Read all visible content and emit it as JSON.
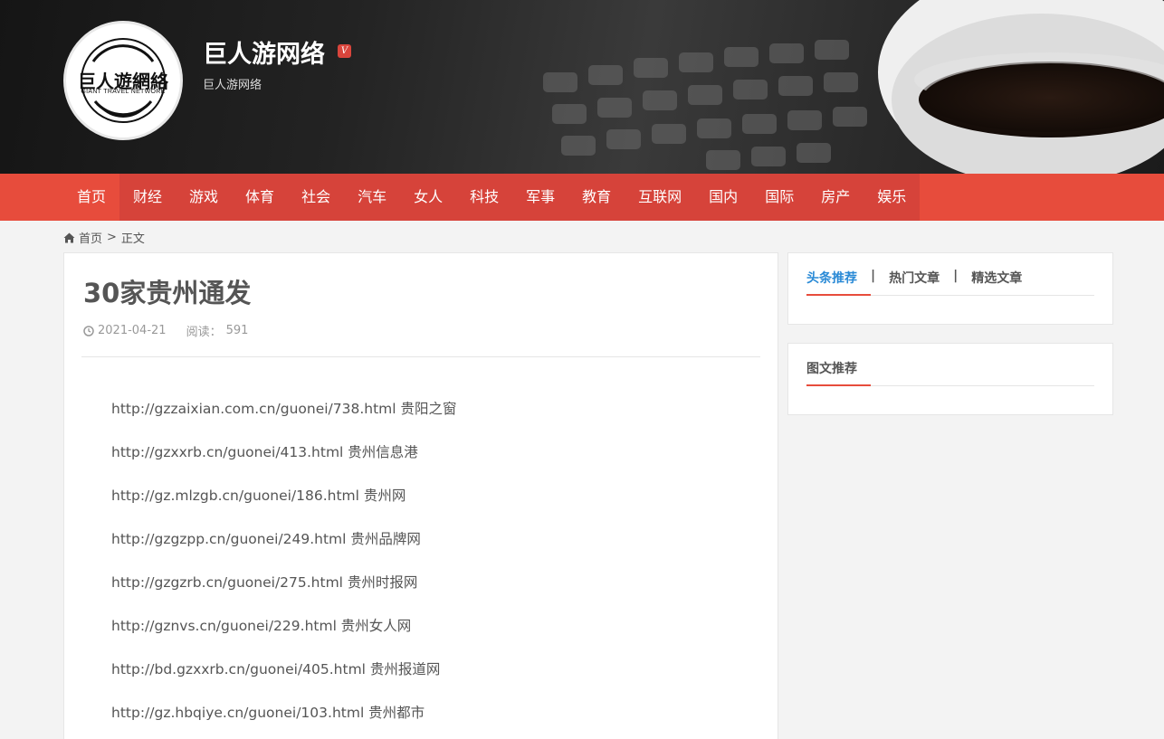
{
  "header": {
    "logo_text": "巨人遊網絡",
    "logo_subtext": "GIANT TRAVEL NETWORK",
    "site_title": "巨人游网络",
    "badge": "V",
    "site_subtitle": "巨人游网络"
  },
  "nav": {
    "items": [
      "首页",
      "财经",
      "游戏",
      "体育",
      "社会",
      "汽车",
      "女人",
      "科技",
      "军事",
      "教育",
      "互联网",
      "国内",
      "国际",
      "房产",
      "娱乐"
    ]
  },
  "breadcrumb": {
    "home": "首页",
    "separator": ">",
    "current": "正文"
  },
  "article": {
    "title": "30家贵州通发",
    "date": "2021-04-21",
    "views_label": "阅读：",
    "views": "591",
    "lines": [
      "http://gzzaixian.com.cn/guonei/738.html 贵阳之窗",
      "http://gzxxrb.cn/guonei/413.html 贵州信息港",
      "http://gz.mlzgb.cn/guonei/186.html 贵州网",
      "http://gzgzpp.cn/guonei/249.html 贵州品牌网",
      "http://gzgzrb.cn/guonei/275.html 贵州时报网",
      "http://gznvs.cn/guonei/229.html 贵州女人网",
      "http://bd.gzxxrb.cn/guonei/405.html 贵州报道网",
      "http://gz.hbqiye.cn/guonei/103.html 贵州都市"
    ]
  },
  "sidebar": {
    "tabs": [
      "头条推荐",
      "热门文章",
      "精选文章"
    ],
    "tab_separator": "|",
    "widget2_title": "图文推荐"
  },
  "colors": {
    "nav_bg": "#e74c3c",
    "nav_inner_bg": "#d6433a",
    "active_tab": "#2a8ad6",
    "accent": "#e74c3c"
  }
}
